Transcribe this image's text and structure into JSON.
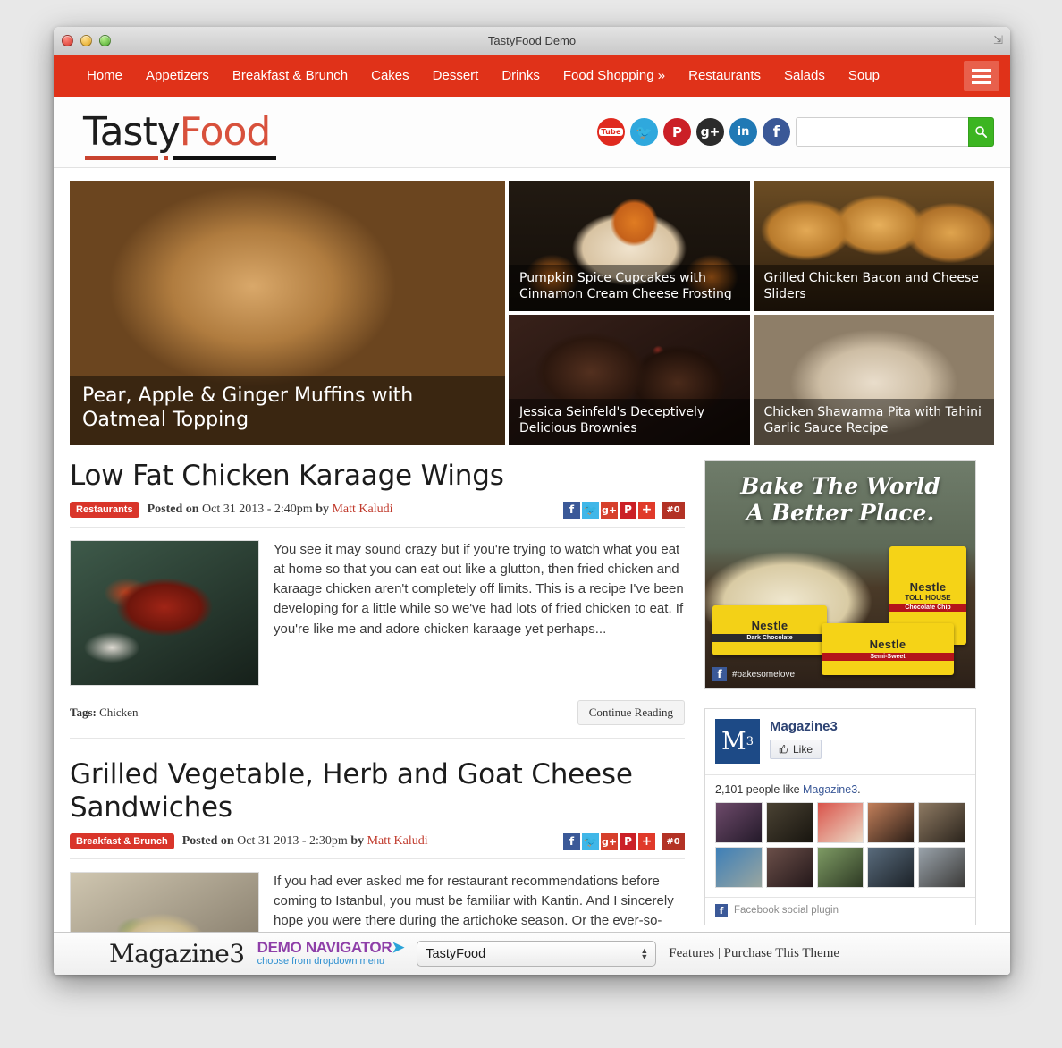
{
  "window": {
    "title": "TastyFood Demo",
    "traffic_lights": [
      "close",
      "minimize",
      "zoom"
    ],
    "resize_glyph": "⇲"
  },
  "topnav": {
    "items": [
      {
        "label": "Home"
      },
      {
        "label": "Appetizers"
      },
      {
        "label": "Breakfast & Brunch"
      },
      {
        "label": "Cakes"
      },
      {
        "label": "Dessert"
      },
      {
        "label": "Drinks"
      },
      {
        "label": "Food Shopping »"
      },
      {
        "label": "Restaurants"
      },
      {
        "label": "Salads"
      },
      {
        "label": "Soup"
      }
    ],
    "menu_icon": "hamburger-icon",
    "bg_color": "#e03219",
    "menu_btn_color": "#e8604c"
  },
  "brand": {
    "part1": "Tasty",
    "part2": "Food",
    "part1_color": "#1d1d1d",
    "part2_color": "#d8513c"
  },
  "social": [
    {
      "name": "youtube-icon",
      "glyph": "Tube",
      "color": "#e02a1f"
    },
    {
      "name": "twitter-icon",
      "glyph": "ᵗ",
      "color": "#2fa8dd"
    },
    {
      "name": "pinterest-icon",
      "glyph": "P",
      "color": "#cb2027"
    },
    {
      "name": "googleplus-icon",
      "glyph": "g",
      "color": "#2b2b2b"
    },
    {
      "name": "linkedin-icon",
      "glyph": "in",
      "color": "#2079b5"
    },
    {
      "name": "facebook-icon",
      "glyph": "f",
      "color": "#3a5897"
    }
  ],
  "search": {
    "value": "",
    "placeholder": "",
    "button_icon": "search-icon",
    "button_color": "#3cb521"
  },
  "featured": {
    "big": {
      "caption": "Pear, Apple & Ginger Muffins with Oatmeal Topping",
      "image": "muffins-photo"
    },
    "small": [
      {
        "caption": "Pumpkin Spice Cupcakes with Cinnamon Cream Cheese Frosting",
        "image": "cupcake-photo"
      },
      {
        "caption": "Grilled Chicken Bacon and Cheese Sliders",
        "image": "sliders-photo"
      },
      {
        "caption": "Jessica Seinfeld's Deceptively Delicious Brownies",
        "image": "brownies-photo"
      },
      {
        "caption": "Chicken Shawarma Pita with Tahini Garlic Sauce Recipe",
        "image": "shawarma-photo"
      }
    ]
  },
  "posts": [
    {
      "title": "Low Fat Chicken Karaage Wings",
      "category": "Restaurants",
      "posted_label": "Posted on",
      "date": "Oct 31 2013 - 2:40pm",
      "by_label": "by",
      "author": "Matt Kaludi",
      "comments": "#0",
      "image": "chicken-wings-photo",
      "excerpt": "You see it may sound crazy but if you're trying to watch what you eat at home so that you can eat out like a glutton, then fried chicken and karaage chicken aren't completely off limits. This is a recipe I've been developing for a little while so we've had lots of fried chicken to eat. If you're like me and adore chicken karaage yet perhaps...",
      "tags_label": "Tags:",
      "tags": "Chicken",
      "continue_label": "Continue Reading"
    },
    {
      "title": "Grilled Vegetable, Herb and Goat Cheese Sandwiches",
      "category": "Breakfast & Brunch",
      "posted_label": "Posted on",
      "date": "Oct 31 2013 - 2:30pm",
      "by_label": "by",
      "author": "Matt Kaludi",
      "comments": "#0",
      "image": "goat-cheese-sandwich-photo",
      "excerpt": "If you had ever asked me for restaurant recommendations before coming to Istanbul, you must be familiar with Kantin. And I sincerely hope you were there during the artichoke season. Or the ever-so-short snap pea season. Şemsa Denizsel, chef and owner of Kantin, works wonders in the kitchen. And as you're reading this, she's"
    }
  ],
  "share_buttons": [
    {
      "name": "facebook-share",
      "glyph": "f",
      "color": "#3b5998"
    },
    {
      "name": "twitter-share",
      "glyph": "ᵗ",
      "color": "#41b7e8"
    },
    {
      "name": "googleplus-share",
      "glyph": "g",
      "color": "#d6402c"
    },
    {
      "name": "pinterest-share",
      "glyph": "P",
      "color": "#cb2027"
    },
    {
      "name": "more-share",
      "glyph": "+",
      "color": "#e03a2a"
    }
  ],
  "sidebar": {
    "ad": {
      "headline_line1": "Bake The World",
      "headline_line2": "A Better Place.",
      "hashtag": "#bakesomelove",
      "brand": "Nestle",
      "sub_brand": "TOLL HOUSE",
      "variants": [
        "Chocolate Chip",
        "Dark Chocolate",
        "Semi-Sweet"
      ]
    },
    "facebook_widget": {
      "page_name": "Magazine3",
      "logo_text": "M",
      "logo_sup": "3",
      "like_label": "Like",
      "like_icon": "thumbs-up-icon",
      "count_prefix": "2,101 people like ",
      "count_link": "Magazine3",
      "count_suffix": ".",
      "avatar_count": 10,
      "footer_label": "Facebook social plugin"
    }
  },
  "demobar": {
    "brand": "Magazine3",
    "nav_title": "DEMO NAVIGATOR",
    "nav_arrow": "➤",
    "nav_sub": "choose from dropdown menu",
    "select_value": "TastyFood",
    "select_options": [
      "TastyFood"
    ],
    "features_label": "Features",
    "divider": "|",
    "purchase_label": "Purchase This Theme"
  }
}
